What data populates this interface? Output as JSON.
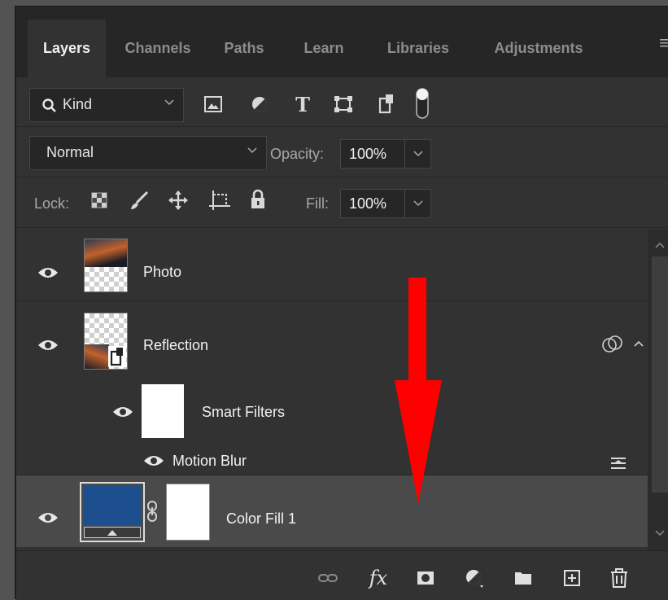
{
  "tabs": [
    {
      "label": "Layers",
      "active": true
    },
    {
      "label": "Channels",
      "active": false
    },
    {
      "label": "Paths",
      "active": false
    },
    {
      "label": "Learn",
      "active": false
    },
    {
      "label": "Libraries",
      "active": false
    },
    {
      "label": "Adjustments",
      "active": false
    }
  ],
  "filter": {
    "kind_label": "Kind"
  },
  "blend": {
    "mode": "Normal",
    "opacity_label": "Opacity:",
    "opacity_value": "100%"
  },
  "lock": {
    "label": "Lock:",
    "fill_label": "Fill:",
    "fill_value": "100%"
  },
  "layers": [
    {
      "name": "Photo",
      "visible": true
    },
    {
      "name": "Reflection",
      "visible": true
    },
    {
      "name": "Smart Filters",
      "visible": true
    },
    {
      "name": "Motion Blur",
      "visible": true
    },
    {
      "name": "Color Fill 1",
      "visible": true,
      "selected": true,
      "fill_color": "#1d4f8f"
    }
  ],
  "annotation": {
    "arrow_color": "#ff0000"
  },
  "colors": {
    "panel_bg": "#323232",
    "tab_bar_bg": "#262626",
    "selected_row": "#4a4a4a"
  },
  "bottom_icons": [
    "link-layers-icon",
    "fx-icon",
    "add-mask-icon",
    "adjustment-layer-icon",
    "new-group-icon",
    "new-layer-icon",
    "delete-icon"
  ]
}
